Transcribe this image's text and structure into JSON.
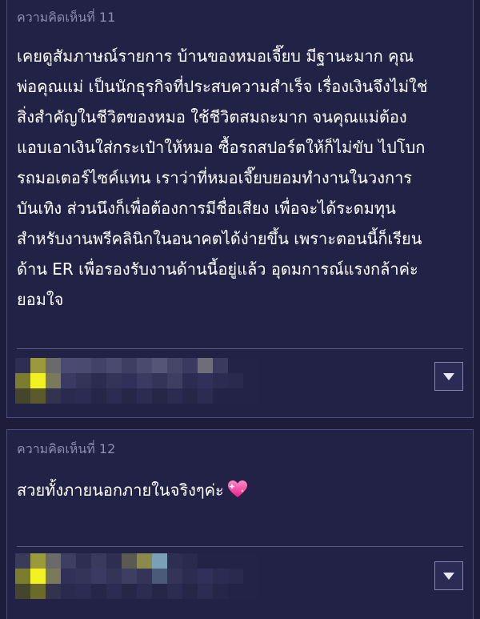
{
  "comments": [
    {
      "header": "ความคิดเห็นที่ 11",
      "lines": [
        "เคยดูสัมภาษณ์รายการ บ้านของหมอเจี๊ยบ มีฐานะมาก คุณ",
        "พ่อคุณแม่ เป็นนักธุรกิจที่ประสบความสำเร็จ เรื่องเงินจึงไม่ใช่",
        "สิ่งสำคัญในชีวิตของหมอ  ใช้ชีวิตสมถะมาก จนคุณแม่ต้อง",
        "แอบเอาเงินใส่กระเป๋าให้หมอ ซื้อรถสปอร์ตให้ก็ไม่ขับ ไปโบก",
        "รถมอเตอร์ไซค์แทน เราว่าที่หมอเจี๊ยบยอมทำงานในวงการ",
        "บันเทิง ส่วนนึงก็เพื่อต้องการมีชื่อเสียง เพื่อจะได้ระดมทุน",
        "สำหรับงานพรีคลินิกในอนาคตได้ง่ายขึ้น เพราะตอนนี้ก็เรียน",
        "ด้าน ER เพื่อรองรับงานด้านนี้อยู่แล้ว อุดมการณ์แรงกล้าค่ะ",
        "ยอมใจ"
      ],
      "menu_icon": "triangle-down"
    },
    {
      "header": "ความคิดเห็นที่ 12",
      "lines": [
        "สวยทั้งภายนอกภายในจริงๆค่ะ"
      ],
      "emoji": "sparkling-heart",
      "menu_icon": "triangle-down"
    }
  ],
  "colors": {
    "background": "#1d1d3b",
    "card": "#222246",
    "card_border": "#4d4d78",
    "header_text": "#8d8daf",
    "body_text": "#ffffff",
    "heart": "#ff4fae"
  }
}
